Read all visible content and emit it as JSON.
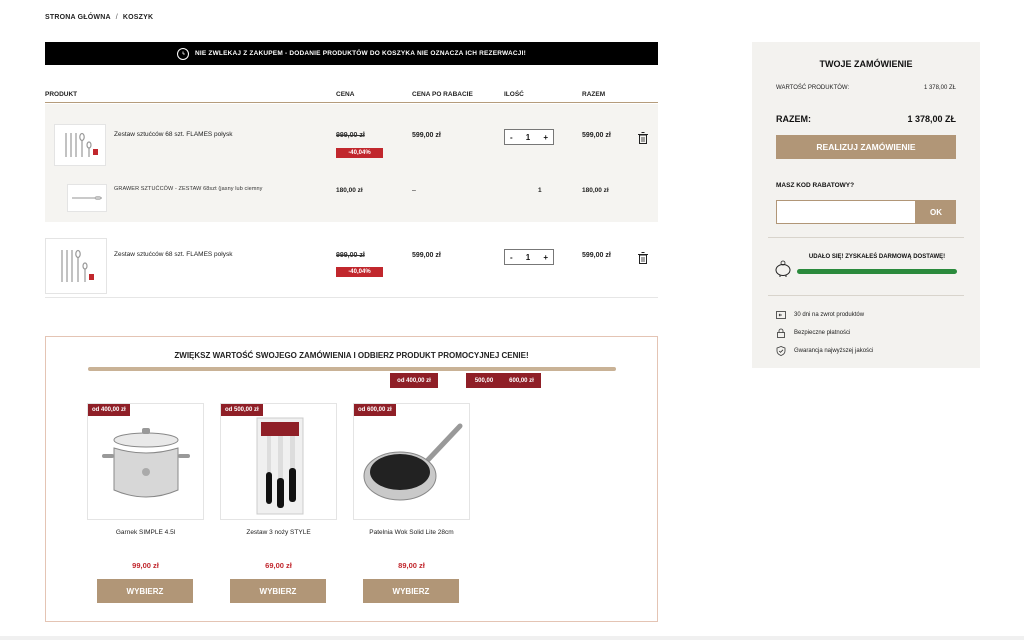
{
  "breadcrumb": {
    "home": "STRONA GŁÓWNA",
    "separator": "/",
    "current": "KOSZYK"
  },
  "banner": {
    "text": "NIE ZWLEKAJ Z ZAKUPEM - DODANIE PRODUKTÓW DO KOSZYKA NIE OZNACZA ICH REZERWACJI!",
    "icon": "clock-icon"
  },
  "table_headers": {
    "product": "PRODUKT",
    "price": "CENA",
    "discount_price": "CENA PO RABACIE",
    "qty": "ILOŚĆ",
    "total": "RAZEM"
  },
  "cart": {
    "item1": {
      "name": "Zestaw sztućców 68 szt. FLAMES połysk",
      "old_price": "999,00 zł",
      "discount": "-40,04%",
      "price": "599,00 zł",
      "qty": "1",
      "minus": "-",
      "plus": "+",
      "total": "599,00 zł"
    },
    "engraving": {
      "name": "GRAWER SZTUĆCÓW - ZESTAW 68szt (jasny lub ciemny",
      "price": "180,00 zł",
      "discount_price": "–",
      "qty": "1",
      "total": "180,00 zł"
    },
    "item2": {
      "name": "Zestaw sztućców 68 szt. FLAMES połysk",
      "old_price": "999,00 zł",
      "discount": "-40,04%",
      "price": "599,00 zł",
      "qty": "1",
      "minus": "-",
      "plus": "+",
      "total": "599,00 zł"
    }
  },
  "promo": {
    "title": "ZWIĘKSZ WARTOŚĆ SWOJEGO ZAMÓWIENIA I ODBIERZ PRODUKT PROMOCYJNEJ CENIE!",
    "thresholds": [
      "od 400,00 zł",
      "500,00",
      "600,00 zł"
    ],
    "products": [
      {
        "badge": "od 400,00 zł",
        "name": "Garnek SIMPLE 4.5l",
        "price": "99,00 zł",
        "button": "WYBIERZ"
      },
      {
        "badge": "od 500,00 zł",
        "name": "Zestaw 3 noży STYLE",
        "price": "69,00 zł",
        "button": "WYBIERZ"
      },
      {
        "badge": "od 600,00 zł",
        "name": "Patelnia Wok Solid Lite 28cm",
        "price": "89,00 zł",
        "button": "WYBIERZ"
      }
    ]
  },
  "summary": {
    "title": "TWOJE ZAMÓWIENIE",
    "products_value_label": "WARTOŚĆ PRODUKTÓW:",
    "products_value": "1 378,00 ZŁ",
    "total_label": "RAZEM:",
    "total": "1 378,00 ZŁ",
    "order_button": "REALIZUJ ZAMÓWIENIE",
    "coupon_label": "MASZ KOD RABATOWY?",
    "coupon_placeholder": "",
    "coupon_button": "OK",
    "shipping_text": "UDAŁO SIĘ! ZYSKAŁEŚ DARMOWĄ DOSTAWĘ!",
    "shipping_progress": 1.0,
    "features": [
      "30 dni na zwrot produktów",
      "Bezpieczne płatności",
      "Gwarancja najwyższej jakości"
    ]
  },
  "colors": {
    "accent": "#b19677",
    "badge_red": "#8f1f27",
    "discount_red": "#c1272d",
    "progress_green": "#2a8a3c"
  }
}
